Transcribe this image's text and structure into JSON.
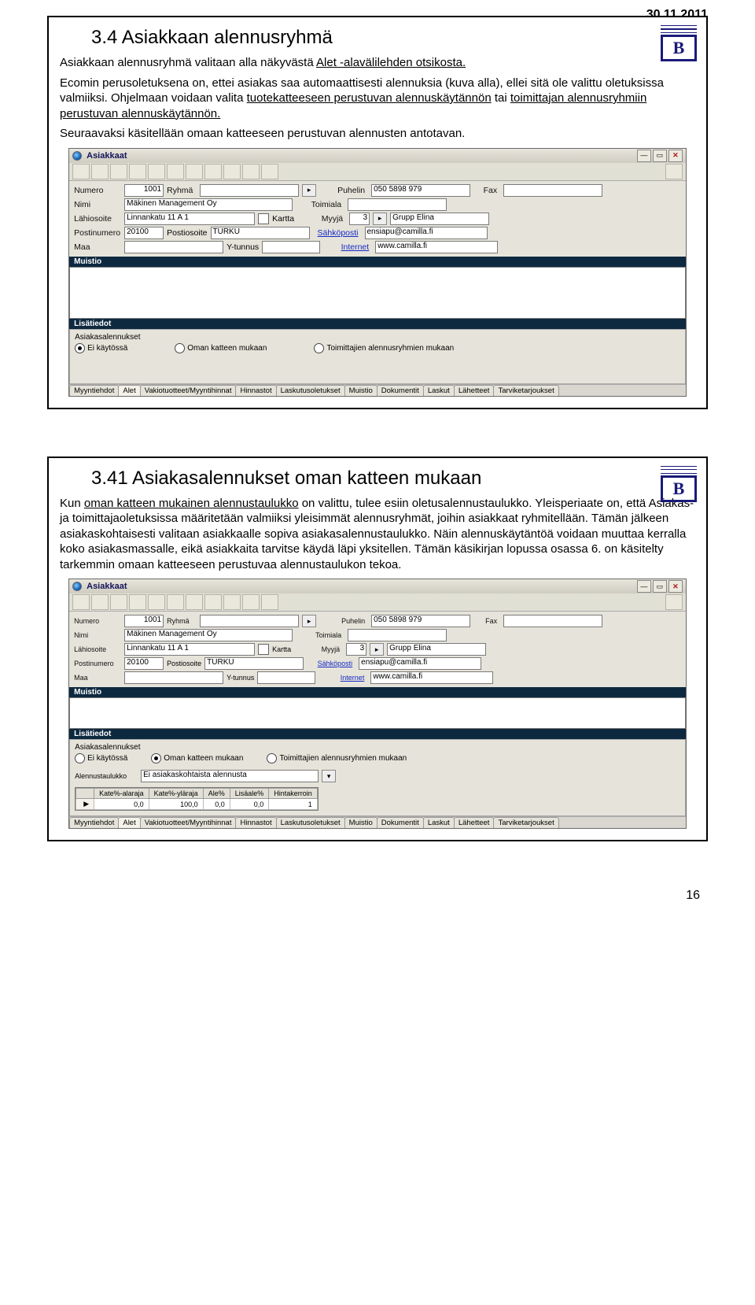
{
  "date_header": "30.11.2011",
  "page_number": "16",
  "logo_letter": "B",
  "section1": {
    "heading": "3.4 Asiakkaan alennusryhmä",
    "para1_a": "Asiakkaan alennusryhmä valitaan alla näkyvästä ",
    "para1_uline": "Alet -alavälilehden otsikosta.",
    "para2_a": "Ecomin perusoletuksena on, ettei asiakas saa automaattisesti alennuksia (kuva alla), ellei sitä ole valittu oletuksissa valmiiksi. Ohjelmaan voidaan valita ",
    "para2_u1": "tuotekatteeseen perustuvan alennuskäytännön",
    "para2_b": " tai ",
    "para2_u2": "toimittajan alennusryhmiin perustuvan alennuskäytännön.",
    "para3": "Seuraavaksi käsitellään omaan katteeseen perustuvan alennusten antotavan."
  },
  "section2": {
    "heading": "3.41 Asiakasalennukset oman katteen mukaan",
    "para_a": "Kun ",
    "para_u1": "oman katteen mukainen alennustaulukko",
    "para_b": " on valittu, tulee esiin oletusalennustaulukko. Yleisperiaate on, että Asiakas- ja toimittajaoletuksissa määritetään valmiiksi yleisimmät alennusryhmät, joihin asiakkaat ryhmitellään. Tämän jälkeen asiakaskohtaisesti valitaan asiakkaalle sopiva asiakasalennustaulukko. Näin alennuskäytäntöä voidaan muuttaa kerralla koko asiakasmassalle, eikä asiakkaita tarvitse käydä läpi yksitellen. Tämän käsikirjan lopussa osassa 6. on käsitelty tarkemmin omaan katteeseen perustuvaa alennustaulukon tekoa."
  },
  "app": {
    "title": "Asiakkaat",
    "labels": {
      "numero": "Numero",
      "ryhma": "Ryhmä",
      "puhelin": "Puhelin",
      "fax": "Fax",
      "nimi": "Nimi",
      "toimiala": "Toimiala",
      "lahiosoite": "Lähiosoite",
      "kartta": "Kartta",
      "myyja": "Myyjä",
      "postinumero": "Postinumero",
      "postiosoite": "Postiosoite",
      "sahkoposti": "Sähköposti",
      "maa": "Maa",
      "ytunnus": "Y-tunnus",
      "internet": "Internet"
    },
    "fields": {
      "numero": "1001",
      "ryhma": "",
      "puhelin": "050 5898 979",
      "fax": "",
      "nimi": "Mäkinen Management Oy",
      "toimiala": "",
      "lahiosoite": "Linnankatu 11 A 1",
      "myyja_num": "3",
      "myyja_name": "Grupp Elina",
      "postinumero": "20100",
      "postiosoite": "TURKU",
      "sahkoposti": "ensiapu@camilla.fi",
      "maa": "",
      "ytunnus": "",
      "internet": "www.camilla.fi"
    },
    "bands": {
      "muistio": "Muistio",
      "lisatiedot": "Lisätiedot"
    },
    "radios": {
      "title": "Asiakasalennukset",
      "opt1": "Ei käytössä",
      "opt2": "Oman katteen mukaan",
      "opt3": "Toimittajien alennusryhmien mukaan"
    },
    "tabs": [
      "Myyntiehdot",
      "Alet",
      "Vakiotuotteet/Myyntihinnat",
      "Hinnastot",
      "Laskutusoletukset",
      "Muistio",
      "Dokumentit",
      "Laskut",
      "Lähetteet",
      "Tarviketarjoukset"
    ]
  },
  "app2": {
    "alennustaulukko_label": "Alennustaulukko",
    "alennustaulukko_value": "Ei asiakaskohtaista alennusta",
    "columns": [
      "Kate%-alaraja",
      "Kate%-yläraja",
      "Ale%",
      "Lisäale%",
      "Hintakerroin"
    ],
    "row": [
      "0,0",
      "100,0",
      "0,0",
      "0,0",
      "1"
    ]
  }
}
